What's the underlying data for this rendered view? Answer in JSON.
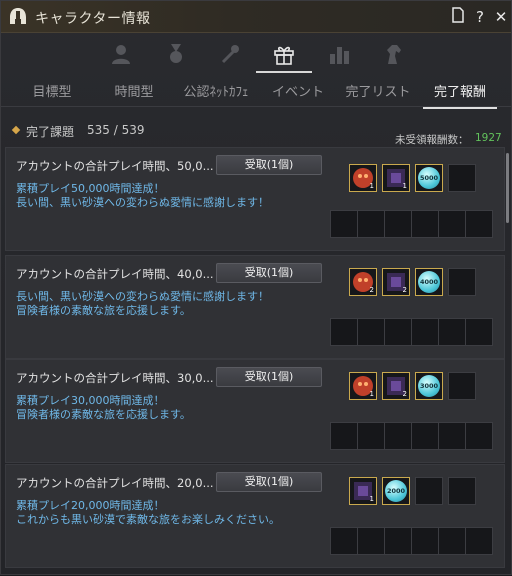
{
  "window": {
    "title": "キャラクター情報",
    "buttons": {
      "export": "🗎",
      "help": "?",
      "close": "✕"
    }
  },
  "icon_tabs": [
    {
      "name": "profile-tab",
      "icon": "person-icon",
      "active": false
    },
    {
      "name": "medal-tab",
      "icon": "medal-icon",
      "active": false
    },
    {
      "name": "tools-tab",
      "icon": "tools-icon",
      "active": false
    },
    {
      "name": "gift-tab",
      "icon": "gift-icon",
      "active": true
    },
    {
      "name": "stats-tab",
      "icon": "bar-chart-icon",
      "active": false
    },
    {
      "name": "horse-tab",
      "icon": "horse-icon",
      "active": false
    }
  ],
  "sub_tabs": [
    {
      "label": "目標型",
      "active": false
    },
    {
      "label": "時間型",
      "active": false
    },
    {
      "label": "公認ﾈｯﾄｶﾌｪ",
      "active": false
    },
    {
      "label": "イベント",
      "active": false
    },
    {
      "label": "完了リスト",
      "active": false
    },
    {
      "label": "完了報酬",
      "active": true
    }
  ],
  "summary": {
    "label": "完了課題",
    "count": "535 / 539",
    "unclaimed_label": "未受領報酬数：",
    "unclaimed_value": "1927"
  },
  "colors": {
    "accent_green": "#62c25c",
    "desc_blue": "#6fb8e8",
    "slot_gold": "#c9a94e"
  },
  "rewards": [
    {
      "title": "アカウントの合計プレイ時間、50,0...",
      "button": "受取(1個)",
      "desc": "累積プレイ50,000時間達成！\n長い間、黒い砂漠への変わらぬ愛情に感謝します！",
      "items": [
        {
          "icon": "pet-doll-icon",
          "qty": "1"
        },
        {
          "icon": "outfit-box-icon",
          "qty": "1"
        },
        {
          "icon": "silver-coin-icon",
          "qty": "5000"
        }
      ]
    },
    {
      "title": "アカウントの合計プレイ時間、40,0...",
      "button": "受取(1個)",
      "desc": "長い間、黒い砂漠への変わらぬ愛情に感謝します！\n冒険者様の素敵な旅を応援します。",
      "items": [
        {
          "icon": "pet-doll-icon",
          "qty": "2"
        },
        {
          "icon": "outfit-box-icon",
          "qty": "2"
        },
        {
          "icon": "silver-coin-icon",
          "qty": "4000"
        }
      ]
    },
    {
      "title": "アカウントの合計プレイ時間、30,0...",
      "button": "受取(1個)",
      "desc": "累積プレイ30,000時間達成！\n冒険者様の素敵な旅を応援します。",
      "items": [
        {
          "icon": "pet-doll-icon",
          "qty": "1"
        },
        {
          "icon": "outfit-box-icon",
          "qty": "2"
        },
        {
          "icon": "silver-coin-icon",
          "qty": "3000"
        }
      ]
    },
    {
      "title": "アカウントの合計プレイ時間、20,0...",
      "button": "受取(1個)",
      "desc": "累積プレイ20,000時間達成！\nこれからも黒い砂漠で素敵な旅をお楽しみください。",
      "items": [
        {
          "icon": "outfit-box-icon",
          "qty": "1"
        },
        {
          "icon": "silver-coin-icon",
          "qty": "2000"
        }
      ]
    }
  ]
}
